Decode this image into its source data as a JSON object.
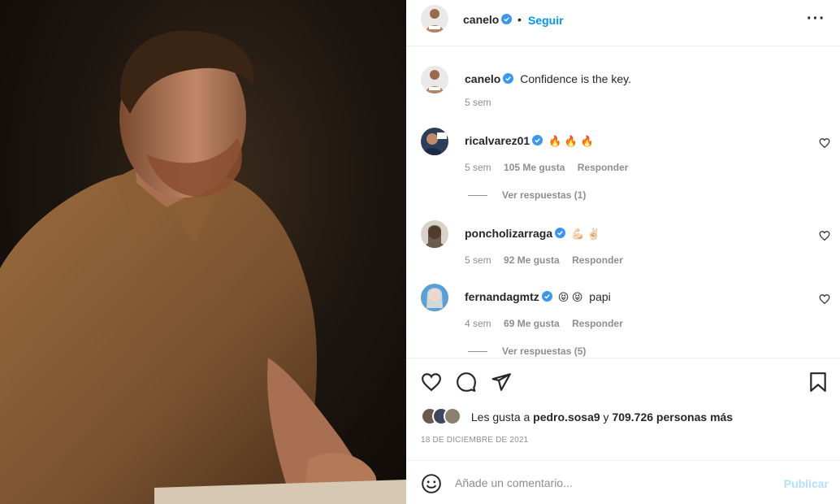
{
  "post": {
    "photo_alt": "man in brown polo shirt",
    "author": {
      "username": "canelo",
      "verified": true
    },
    "follow_label": "Seguir",
    "separator": "•",
    "more_icon": "more-options-icon"
  },
  "caption": {
    "username": "canelo",
    "text": "Confidence is the key.",
    "time": "5 sem"
  },
  "comments": [
    {
      "username": "ricalvarez01",
      "emojis": "🔥 🔥 🔥",
      "text": "",
      "time": "5 sem",
      "likes": "105 Me gusta",
      "reply": "Responder",
      "view_replies": "Ver respuestas (1)"
    },
    {
      "username": "poncholizarraga",
      "emojis": "💪🏻 ✌🏻",
      "text": "",
      "time": "5 sem",
      "likes": "92 Me gusta",
      "reply": "Responder"
    },
    {
      "username": "fernandagmtz",
      "emojis": "😝 😝",
      "text": "papi",
      "time": "4 sem",
      "likes": "69 Me gusta",
      "reply": "Responder",
      "view_replies": "Ver respuestas (5)"
    }
  ],
  "likes": {
    "prefix": "Les gusta a ",
    "user": "pedro.sosa9",
    "middle": " y ",
    "others": "709.726 personas más"
  },
  "date": "18 DE DICIEMBRE DE 2021",
  "add_comment": {
    "placeholder": "Añade un comentario...",
    "publish_label": "Publicar"
  },
  "colors": {
    "accent": "#0095f6",
    "verified": "#3897f0",
    "muted": "#8e8e8e",
    "publish_disabled": "#b2dffc"
  }
}
